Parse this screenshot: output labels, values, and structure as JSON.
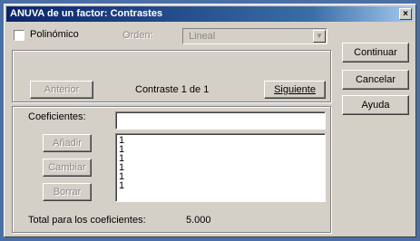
{
  "window": {
    "title": "ANUVA de un factor: Contrastes",
    "close_glyph": "×"
  },
  "polynomial": {
    "checkbox_label": "Polinómico",
    "degree_label": "Orden:",
    "degree_value": "Lineal"
  },
  "contrast_nav": {
    "previous_label": "Anterior",
    "counter_text": "Contraste 1 de 1",
    "next_label": "Siguiente"
  },
  "coefficients": {
    "label": "Coeficientes:",
    "input_value": "",
    "add_label": "Añadir",
    "change_label": "Cambiar",
    "remove_label": "Borrar",
    "values": [
      "1",
      "1",
      "1",
      "1",
      "1",
      "1"
    ]
  },
  "total": {
    "label": "Total para los coeficientes:",
    "value": "5.000"
  },
  "actions": {
    "continue_label": "Continuar",
    "cancel_label": "Cancelar",
    "help_label": "Ayuda"
  }
}
